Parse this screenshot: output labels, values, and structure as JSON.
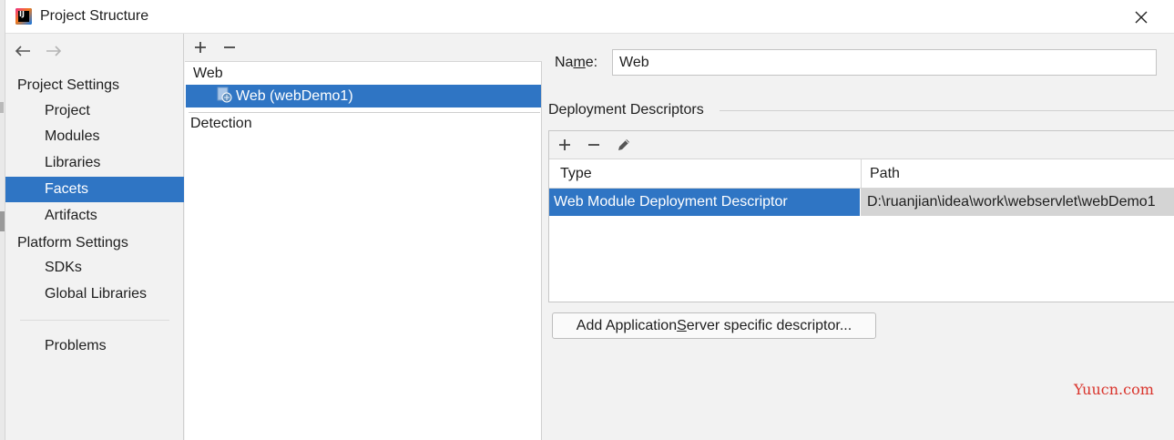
{
  "window": {
    "title": "Project Structure",
    "app_icon": "intellij-idea-icon",
    "app_icon_text": "IJ"
  },
  "sidebar": {
    "nav": {
      "back_icon": "arrow-left-icon",
      "forward_icon": "arrow-right-icon"
    },
    "items": [
      {
        "label": "Project Settings",
        "level": 1,
        "selected": false
      },
      {
        "label": "Project",
        "level": 2,
        "selected": false
      },
      {
        "label": "Modules",
        "level": 2,
        "selected": false
      },
      {
        "label": "Libraries",
        "level": 2,
        "selected": false
      },
      {
        "label": "Facets",
        "level": 2,
        "selected": true
      },
      {
        "label": "Artifacts",
        "level": 2,
        "selected": false
      },
      {
        "label": "Platform Settings",
        "level": 1,
        "selected": false
      },
      {
        "label": "SDKs",
        "level": 2,
        "selected": false
      },
      {
        "label": "Global Libraries",
        "level": 2,
        "selected": false
      },
      {
        "label": "Problems",
        "level": 2,
        "selected": false
      }
    ]
  },
  "facets_tree": {
    "toolbar": {
      "add_icon": "plus-icon",
      "remove_icon": "minus-icon"
    },
    "group_web": "Web",
    "item_web": "Web (webDemo1)",
    "group_detection": "Detection"
  },
  "detail": {
    "name_label_pre": "Na",
    "name_label_mnemonic": "m",
    "name_label_post": "e:",
    "name_value": "Web",
    "section_title": "Deployment Descriptors",
    "toolbar": {
      "add_icon": "plus-icon",
      "remove_icon": "minus-icon",
      "edit_icon": "pencil-icon"
    },
    "columns": {
      "type": "Type",
      "path": "Path"
    },
    "rows": [
      {
        "type": "Web Module Deployment Descriptor",
        "path": "D:\\ruanjian\\idea\\work\\webservlet\\webDemo1"
      }
    ],
    "add_button_pre": "Add Application ",
    "add_button_mnemonic": "S",
    "add_button_post": "erver specific descriptor..."
  },
  "watermark": "Yuucn.com",
  "colors": {
    "selection": "#2f75c4",
    "panel_bg": "#f2f2f2",
    "watermark": "#d9332b"
  }
}
